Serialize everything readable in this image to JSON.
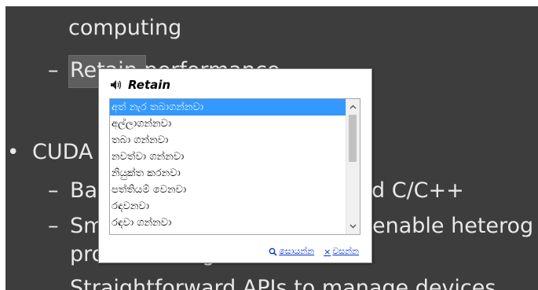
{
  "slide": {
    "line_top_partial": "",
    "line_computing": "computing",
    "line_retain_prefix": "Retain",
    "line_retain_suffix": " performance",
    "line_cuda": "CUDA",
    "line_bas": "Bas",
    "line_bas_tail": "d C/C++",
    "line_sm": "Sm",
    "line_sm_tail": "enable heterog",
    "line_pro": "pro",
    "line_pro_tail": "g",
    "line_straightforward": "Straightforward APIs to manage devices",
    "dash": "–",
    "bullet": "•"
  },
  "popup": {
    "headword": "Retain",
    "speaker_icon": "speaker-icon",
    "items": [
      "අත් නැර තබාගන්නවා",
      "අල්ලාගන්නවා",
      "තබා ගන්නවා",
      "නවත්වා ගන්නවා",
      "නියුක්ත කරනවා",
      "පත්තියම් වෙනවා",
      "රඳවනවා",
      "රඳවා ගන්නවා"
    ],
    "selected_index": 0,
    "footer": {
      "search_label": "සොයන්න",
      "search_icon": "magnifier-icon",
      "close_label": "වසන්න",
      "close_icon": "close-icon"
    }
  },
  "colors": {
    "slide_bg": "#3d3d3d",
    "slide_text": "#e8e8e8",
    "selection": "#3399ff",
    "link": "#0033cc"
  }
}
